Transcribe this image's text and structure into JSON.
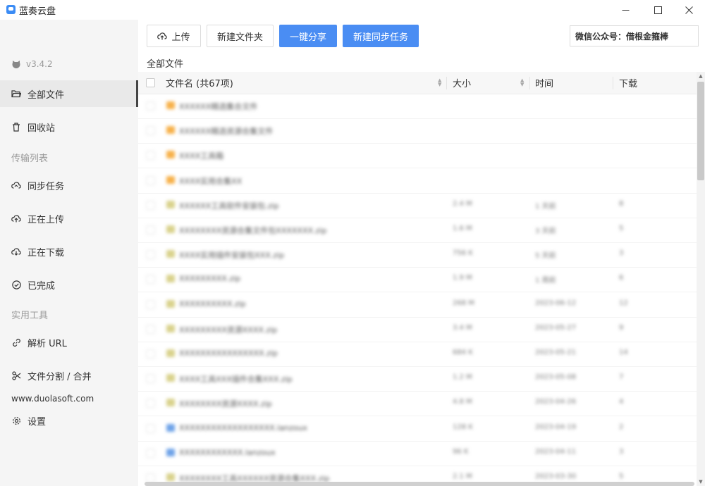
{
  "app": {
    "title": "蓝奏云盘"
  },
  "sidebar": {
    "version": "v3.4.2",
    "items": [
      {
        "label": "全部文件",
        "icon": "folder-icon"
      },
      {
        "label": "回收站",
        "icon": "trash-icon"
      }
    ],
    "transfer_label": "传输列表",
    "transfer_items": [
      {
        "label": "同步任务",
        "icon": "cloud-sync-icon"
      },
      {
        "label": "正在上传",
        "icon": "cloud-upload-icon"
      },
      {
        "label": "正在下载",
        "icon": "cloud-download-icon"
      },
      {
        "label": "已完成",
        "icon": "check-circle-icon"
      }
    ],
    "tools_label": "实用工具",
    "tool_items": [
      {
        "label": "解析 URL",
        "icon": "link-icon"
      },
      {
        "label": "文件分割 / 合并",
        "icon": "scissors-icon"
      }
    ],
    "site": "www.duolasoft.com",
    "settings_label": "设置"
  },
  "toolbar": {
    "upload_label": "上传",
    "new_folder_label": "新建文件夹",
    "share_label": "一键分享",
    "sync_label": "新建同步任务",
    "search_text": "微信公众号：借根金箍棒"
  },
  "breadcrumb": "全部文件",
  "table": {
    "col_name": "文件名 (共67项)",
    "col_size": "大小",
    "col_time": "时间",
    "col_download": "下载",
    "rows": [
      {
        "name": "XXXXXX精选集合文件",
        "size": "",
        "time": "",
        "downloads": "",
        "type": "folder"
      },
      {
        "name": "XXXXXX精选资源合集文件",
        "size": "",
        "time": "",
        "downloads": "",
        "type": "folder"
      },
      {
        "name": "XXXX工具箱",
        "size": "",
        "time": "",
        "downloads": "",
        "type": "folder"
      },
      {
        "name": "XXXX实用合集XX",
        "size": "",
        "time": "",
        "downloads": "",
        "type": "folder"
      },
      {
        "name": "XXXXXX工具软件安装包.zip",
        "size": "2.4 M",
        "time": "1 天前",
        "downloads": "8",
        "type": "file"
      },
      {
        "name": "XXXXXXXX资源合集文件包XXXXXXX.zip",
        "size": "1.6 M",
        "time": "3 天前",
        "downloads": "5",
        "type": "file"
      },
      {
        "name": "XXXX实用插件安装包XXX.zip",
        "size": "756 K",
        "time": "5 天前",
        "downloads": "3",
        "type": "file"
      },
      {
        "name": "XXXXXXXXX.zip",
        "size": "1.9 M",
        "time": "1 周前",
        "downloads": "6",
        "type": "file"
      },
      {
        "name": "XXXXXXXXXX.zip",
        "size": "268 M",
        "time": "2023-06-12",
        "downloads": "12",
        "type": "file"
      },
      {
        "name": "XXXXXXXXX资源XXXX.zip",
        "size": "3.4 M",
        "time": "2023-05-27",
        "downloads": "9",
        "type": "file"
      },
      {
        "name": "XXXXXXXXXXXXXXXX.zip",
        "size": "684 K",
        "time": "2023-05-21",
        "downloads": "14",
        "type": "file"
      },
      {
        "name": "XXXX工具XXX插件合集XXX.zip",
        "size": "1.2 M",
        "time": "2023-05-08",
        "downloads": "7",
        "type": "file"
      },
      {
        "name": "XXXXXXXX资源XXXX.zip",
        "size": "4.8 M",
        "time": "2023-04-26",
        "downloads": "4",
        "type": "file"
      },
      {
        "name": "XXXXXXXXXXXXXXXXXX.lanzoux",
        "size": "128 K",
        "time": "2023-04-19",
        "downloads": "2",
        "type": "doc"
      },
      {
        "name": "XXXXXXXXXXXX.lanzoux",
        "size": "96 K",
        "time": "2023-04-11",
        "downloads": "3",
        "type": "doc"
      },
      {
        "name": "XXXXXXXX工具XXXXXX资源合集XXX.zip",
        "size": "2.1 M",
        "time": "2023-03-30",
        "downloads": "5",
        "type": "file"
      }
    ]
  },
  "colors": {
    "accent": "#4a8df3",
    "folder": "#f7b14a",
    "file": "#d9d28c",
    "doc": "#6fa3e8"
  }
}
